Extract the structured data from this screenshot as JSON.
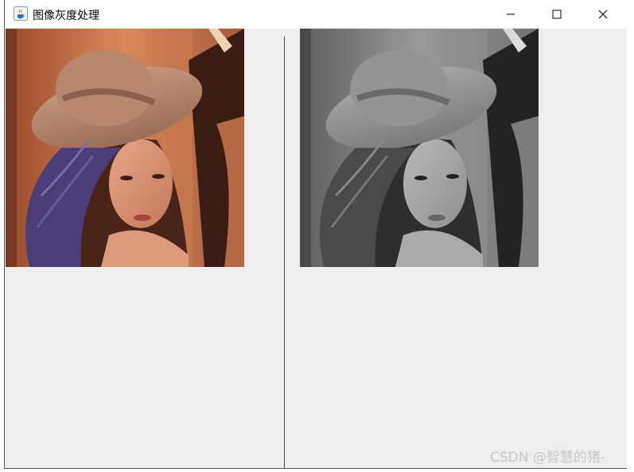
{
  "window": {
    "title": "图像灰度处理",
    "app_icon": "java-cup-icon",
    "controls": {
      "minimize_icon": "minimize-icon",
      "maximize_icon": "maximize-icon",
      "close_icon": "close-icon"
    }
  },
  "panels": [
    {
      "name": "original-image-panel",
      "image": "color-portrait",
      "mode": "color"
    },
    {
      "name": "grayscale-image-panel",
      "image": "grayscale-portrait",
      "mode": "grayscale"
    }
  ],
  "watermark": "CSDN @智慧的猪-",
  "colors": {
    "window_bg": "#eeeeee",
    "titlebar_bg": "#ffffff",
    "divider": "#4a4a4a"
  }
}
